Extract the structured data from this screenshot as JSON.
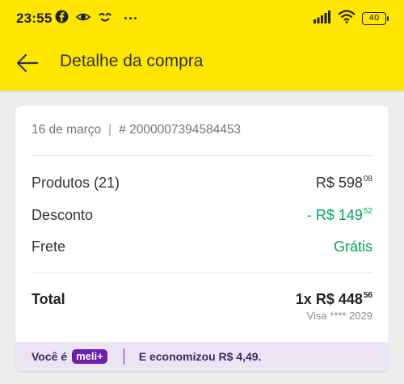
{
  "status_bar": {
    "time": "23:55",
    "dots": "···",
    "battery": "40"
  },
  "nav": {
    "title": "Detalhe da compra"
  },
  "purchase": {
    "date": "16 de março",
    "separator": "|",
    "order_number": "# 2000007394584453"
  },
  "summary": {
    "products_label": "Produtos (21)",
    "products_value": "R$ 598",
    "products_cents": "08",
    "discount_label": "Desconto",
    "discount_value": "- R$ 149",
    "discount_cents": "52",
    "shipping_label": "Frete",
    "shipping_value": "Grátis",
    "total_label": "Total",
    "total_value": "1x R$ 448",
    "total_cents": "56",
    "payment_method": "Visa **** 2029"
  },
  "meli_plus": {
    "prefix": "Você é",
    "badge": "meli+",
    "savings": "E economizou R$ 4,49."
  },
  "colors": {
    "header": "#ffe600",
    "discount_green": "#00a650",
    "meli_purple": "#6b1fb1",
    "meli_bar_bg": "#ebe5f3"
  },
  "icons": [
    "facebook-icon",
    "incognito-icon",
    "face-icon",
    "signal-icon",
    "wifi-icon",
    "battery-icon",
    "back-arrow-icon"
  ]
}
